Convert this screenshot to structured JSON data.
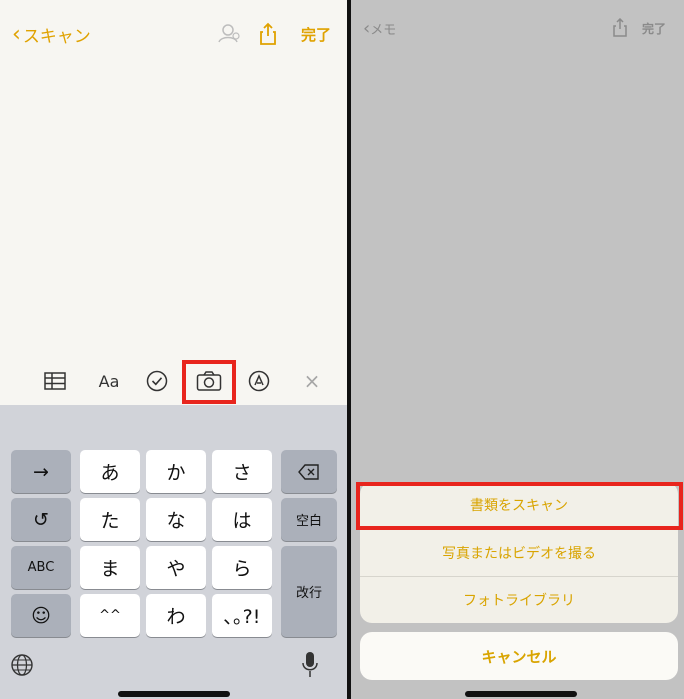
{
  "left": {
    "nav": {
      "back_label": "スキャン",
      "done_label": "完了"
    },
    "keyboard": {
      "rows": [
        [
          "あ",
          "か",
          "さ"
        ],
        [
          "た",
          "な",
          "は"
        ],
        [
          "ま",
          "や",
          "ら"
        ],
        [
          "^^",
          "わ",
          "､｡?!"
        ]
      ],
      "left_keys": [
        "→",
        "↺",
        "ABC",
        "☺"
      ],
      "right_keys": {
        "space": "空白",
        "return": "改行"
      }
    },
    "toolbar": {
      "text_style_label": "Aa",
      "close_glyph": "×"
    }
  },
  "right": {
    "nav": {
      "back_label": "メモ",
      "done_label": "完了"
    },
    "sheet": {
      "items": [
        "書類をスキャン",
        "写真またはビデオを撮る",
        "フォトライブラリ"
      ],
      "cancel": "キャンセル"
    }
  },
  "colors": {
    "accent": "#e0a200",
    "highlight": "#e8251d"
  },
  "icons": [
    "chevron-left-icon",
    "collaborate-icon",
    "share-icon",
    "table-icon",
    "checklist-icon",
    "camera-icon",
    "markup-pen-icon",
    "close-icon",
    "delete-icon",
    "globe-icon",
    "microphone-icon"
  ]
}
